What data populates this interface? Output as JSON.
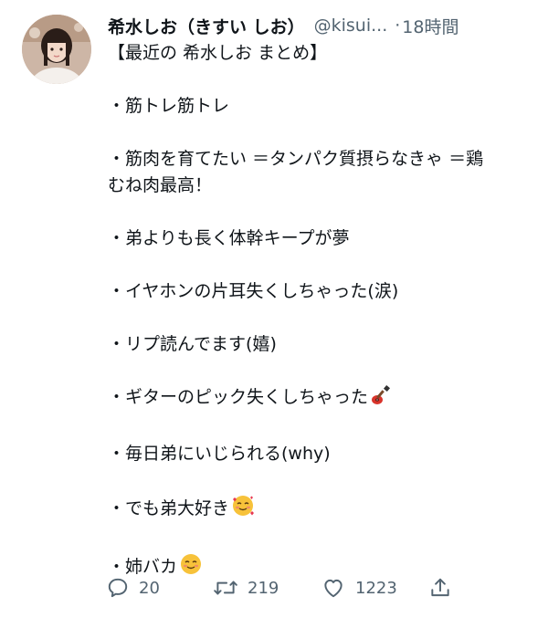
{
  "header": {
    "display_name": "希水しお（きすい しお）",
    "handle": "@kisui...",
    "separator": "·",
    "time": "18時間"
  },
  "body": {
    "lines": [
      "【最近の 希水しお まとめ】",
      "・筋トレ筋トレ",
      "・筋肉を育てたい ＝タンパク質摂らなきゃ ＝鶏",
      "むね肉最高！",
      "・弟よりも長く体幹キープが夢",
      "・イヤホンの片耳失くしちゃった(涙)",
      "・リプ読んでます(嬉)",
      "・ギターのピック失くしちゃった",
      "・毎日弟にいじられる(why)",
      "・でも弟大好き",
      "・姉バカ"
    ],
    "emojis": {
      "guitar": "guitar-emoji",
      "smiling_hearts": "smiling-face-with-hearts-emoji",
      "smiling": "smiling-face-emoji"
    }
  },
  "actions": {
    "reply_count": "20",
    "retweet_count": "219",
    "like_count": "1223",
    "icons": {
      "reply": "reply-icon",
      "retweet": "retweet-icon",
      "like": "heart-icon",
      "share": "share-icon"
    }
  },
  "colors": {
    "text": "#0f1419",
    "secondary": "#536471",
    "background": "#ffffff"
  }
}
